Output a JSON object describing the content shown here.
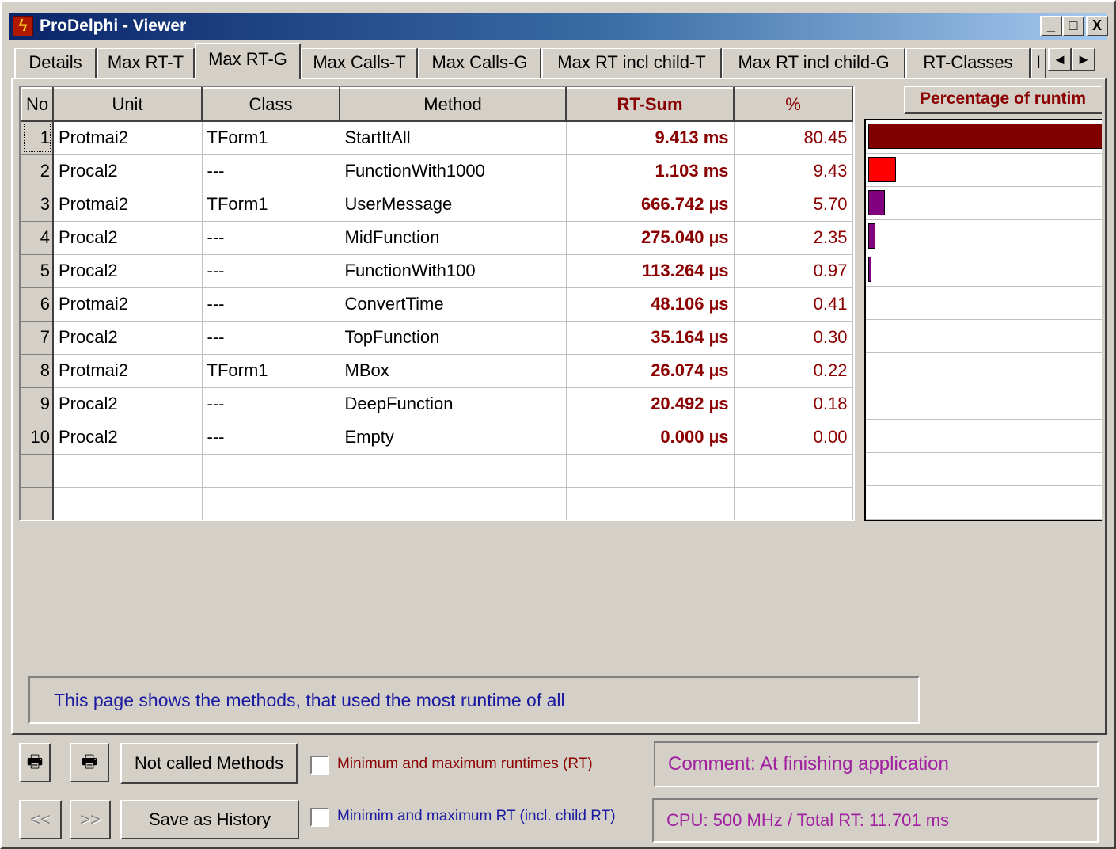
{
  "window": {
    "title": "ProDelphi - Viewer",
    "buttons": {
      "minimize": "_",
      "maximize": "□",
      "close": "X"
    }
  },
  "tabs": [
    {
      "label": "Details"
    },
    {
      "label": "Max RT-T"
    },
    {
      "label": "Max RT-G",
      "active": true
    },
    {
      "label": "Max Calls-T"
    },
    {
      "label": "Max Calls-G"
    },
    {
      "label": "Max RT incl child-T"
    },
    {
      "label": "Max RT incl child-G"
    },
    {
      "label": "RT-Classes"
    },
    {
      "label": "I"
    }
  ],
  "tab_scroll": {
    "left": "◄",
    "right": "►"
  },
  "grid": {
    "columns": [
      "No",
      "Unit",
      "Class",
      "Method",
      "RT-Sum",
      "%"
    ],
    "rows": [
      {
        "no": "1",
        "unit": "Protmai2",
        "class": "TForm1",
        "method": "StartItAll",
        "rt_sum": "9.413 ms",
        "pct": "80.45"
      },
      {
        "no": "2",
        "unit": "Procal2",
        "class": "---",
        "method": "FunctionWith1000",
        "rt_sum": "1.103 ms",
        "pct": "9.43"
      },
      {
        "no": "3",
        "unit": "Protmai2",
        "class": "TForm1",
        "method": "UserMessage",
        "rt_sum": "666.742 µs",
        "pct": "5.70"
      },
      {
        "no": "4",
        "unit": "Procal2",
        "class": "---",
        "method": "MidFunction",
        "rt_sum": "275.040 µs",
        "pct": "2.35"
      },
      {
        "no": "5",
        "unit": "Procal2",
        "class": "---",
        "method": "FunctionWith100",
        "rt_sum": "113.264 µs",
        "pct": "0.97"
      },
      {
        "no": "6",
        "unit": "Protmai2",
        "class": "---",
        "method": "ConvertTime",
        "rt_sum": "48.106 µs",
        "pct": "0.41"
      },
      {
        "no": "7",
        "unit": "Procal2",
        "class": "---",
        "method": "TopFunction",
        "rt_sum": "35.164 µs",
        "pct": "0.30"
      },
      {
        "no": "8",
        "unit": "Protmai2",
        "class": "TForm1",
        "method": "MBox",
        "rt_sum": "26.074 µs",
        "pct": "0.22"
      },
      {
        "no": "9",
        "unit": "Procal2",
        "class": "---",
        "method": "DeepFunction",
        "rt_sum": "20.492 µs",
        "pct": "0.18"
      },
      {
        "no": "10",
        "unit": "Procal2",
        "class": "---",
        "method": "Empty",
        "rt_sum": "0.000 µs",
        "pct": "0.00"
      }
    ]
  },
  "bar_chart": {
    "header": "Percentage of runtim",
    "bars": [
      {
        "value": 80.45,
        "color": "#800000"
      },
      {
        "value": 9.43,
        "color": "#ff0000"
      },
      {
        "value": 5.7,
        "color": "#800080"
      },
      {
        "value": 2.35,
        "color": "#800080"
      },
      {
        "value": 0.97,
        "color": "#800080"
      }
    ]
  },
  "info": {
    "text": "This page shows the methods, that used the most runtime of all"
  },
  "controls": {
    "print1_icon": "printer-icon",
    "print2_icon": "printer-icon",
    "not_called_label": "Not called Methods",
    "prev_label": "<<",
    "next_label": ">>",
    "save_history_label": "Save as History",
    "check_minmax_rt": {
      "label": "Minimum and maximum runtimes (RT)",
      "checked": false,
      "color": "#8b0000"
    },
    "check_minmax_child": {
      "label": "Minimim and maximum RT (incl. child RT)",
      "checked": false,
      "color": "#1a1aa0"
    },
    "comment": "Comment: At finishing application",
    "cpu": "CPU: 500 MHz / Total RT: 11.701 ms"
  }
}
